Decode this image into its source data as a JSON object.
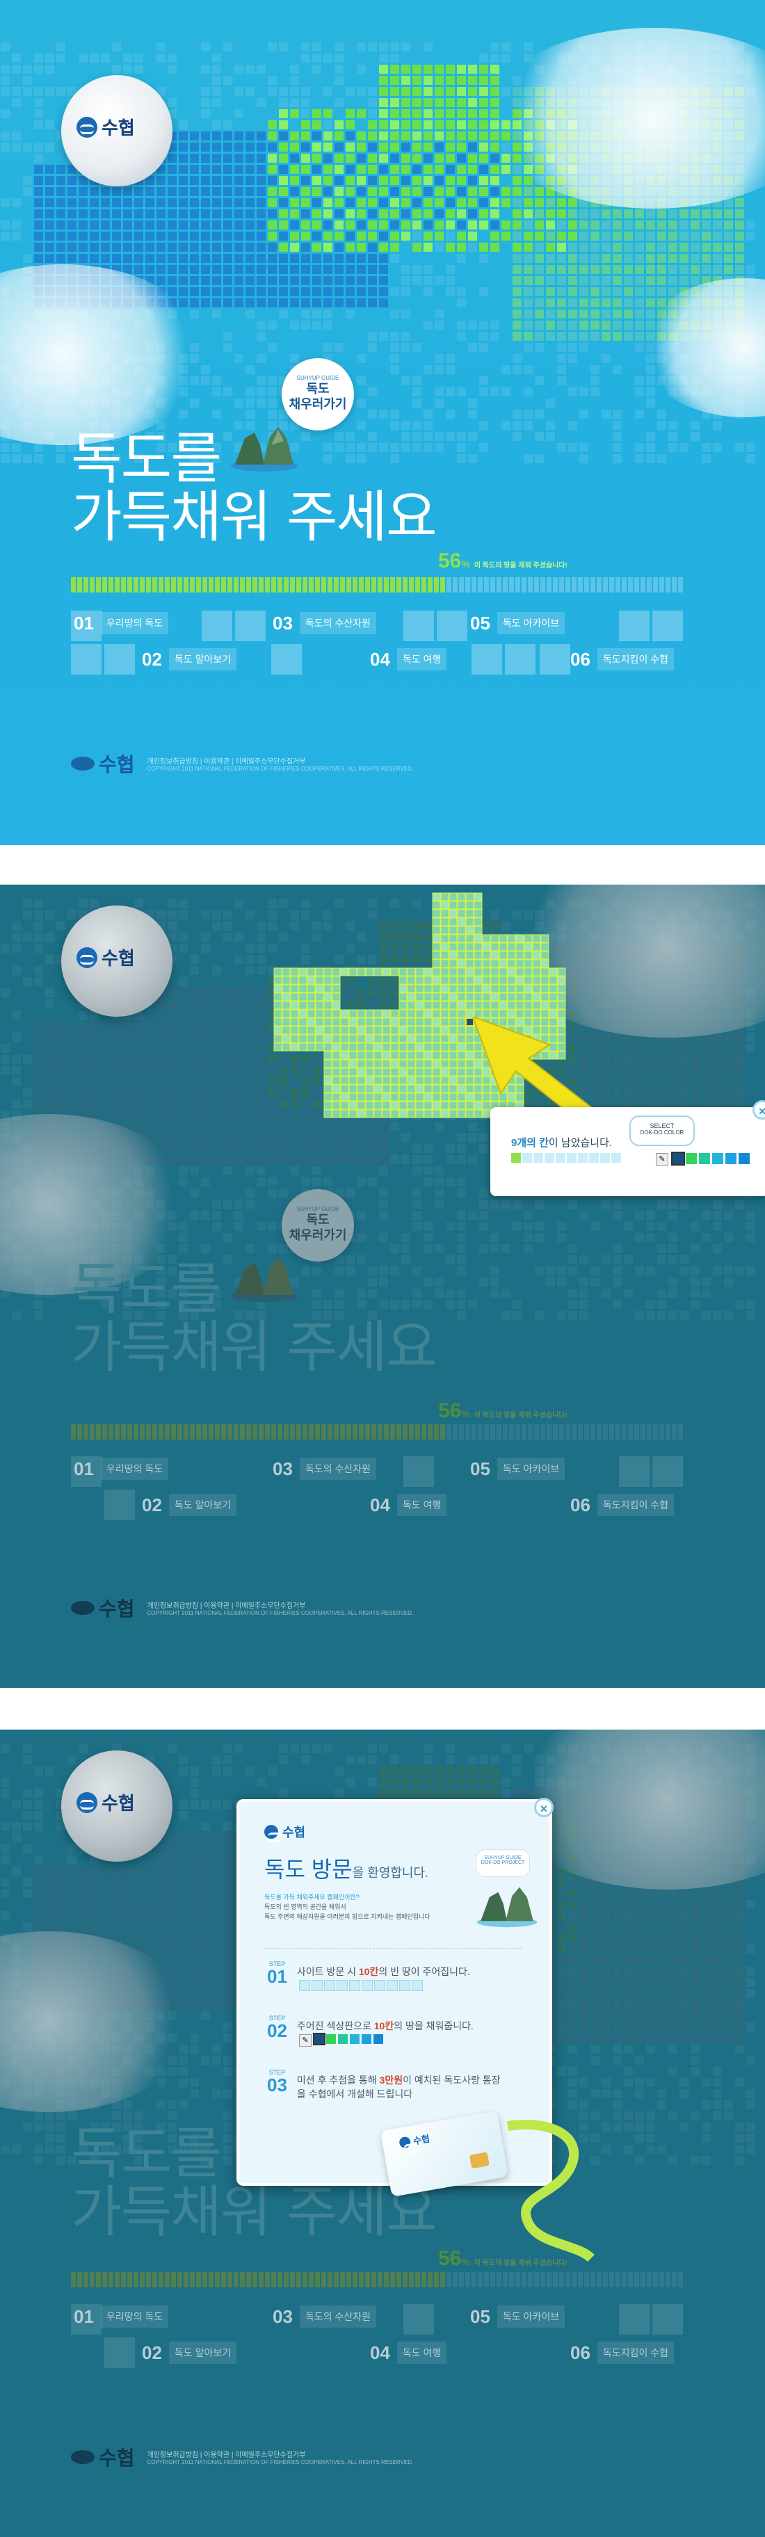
{
  "brand": {
    "logo_text": "수협"
  },
  "headline": {
    "line1": "독도를",
    "line2": "가득채워 주세요"
  },
  "bubble": {
    "small": "SUHYUP GUIDE",
    "big_line1": "독도",
    "big_line2": "채우러가기"
  },
  "progress": {
    "percent_label": "56",
    "unit": "%",
    "note": "이 독도의 땅을 채워 주셨습니다!",
    "value": 0.56
  },
  "menu": [
    {
      "num": "01",
      "label": "우리땅의 독도"
    },
    {
      "num": "02",
      "label": "독도 알아보기"
    },
    {
      "num": "03",
      "label": "독도의 수산자원"
    },
    {
      "num": "04",
      "label": "독도 여행"
    },
    {
      "num": "05",
      "label": "독도 아카이브"
    },
    {
      "num": "06",
      "label": "독도지킴이 수협"
    }
  ],
  "footer": {
    "logo_text": "수협",
    "links": "개인정보취급방침  |  이용약관  |  이메일주소무단수집거부",
    "copy": "COPYRIGHT 2011 NATIONAL FEDERATION OF FISHERIES COOPERATIVES. ALL RIGHTS RESERVED."
  },
  "color_popup": {
    "remaining_count": "9개의 칸",
    "remaining_suffix": "이 남았습니다.",
    "select_label": "SELECT",
    "select_sub": "DOK-DO COLOR",
    "swatches": [
      "#1b4f7d",
      "#33d35c",
      "#25c79c",
      "#22b6d9",
      "#1ea1e0",
      "#1589cf"
    ]
  },
  "welcome": {
    "logo_text": "수협",
    "title_main": "독도 방문",
    "title_suffix": "을 환영합니다.",
    "bubble_small": "SUHYUP GUIDE",
    "bubble_big": "DOK-DO PROJECT",
    "intro_lead": "독도를 가득 채워주세요 캠페인이란?",
    "intro_line1": "독도의 빈 영역의 공간을 채워서",
    "intro_line2": "독도 주변의 해상자원을 여러분의 힘으로 지켜내는 캠페인입니다",
    "steps": [
      {
        "label": "STEP",
        "num": "01",
        "text_a": "사이트 방문 시 ",
        "bold": "10칸",
        "text_b": "의 빈 땅이 주어집니다."
      },
      {
        "label": "STEP",
        "num": "02",
        "text_a": "주어진 색상판으로 ",
        "bold": "10칸",
        "text_b": "의 땅을 채워줍니다."
      },
      {
        "label": "STEP",
        "num": "03",
        "text_a": "미션 후 추첨을 통해 ",
        "bold": "3만원",
        "text_b": "이 예치된 독도사랑 통장을 수협에서 개설해 드립니다"
      }
    ],
    "card_logo": "수협"
  },
  "colors": {
    "accent_green": "#8fe04a",
    "sky": "#23b0e0",
    "dim_bg": "#1d6f86",
    "map_green": "#6ce04a",
    "map_blue": "#1f86d1"
  }
}
